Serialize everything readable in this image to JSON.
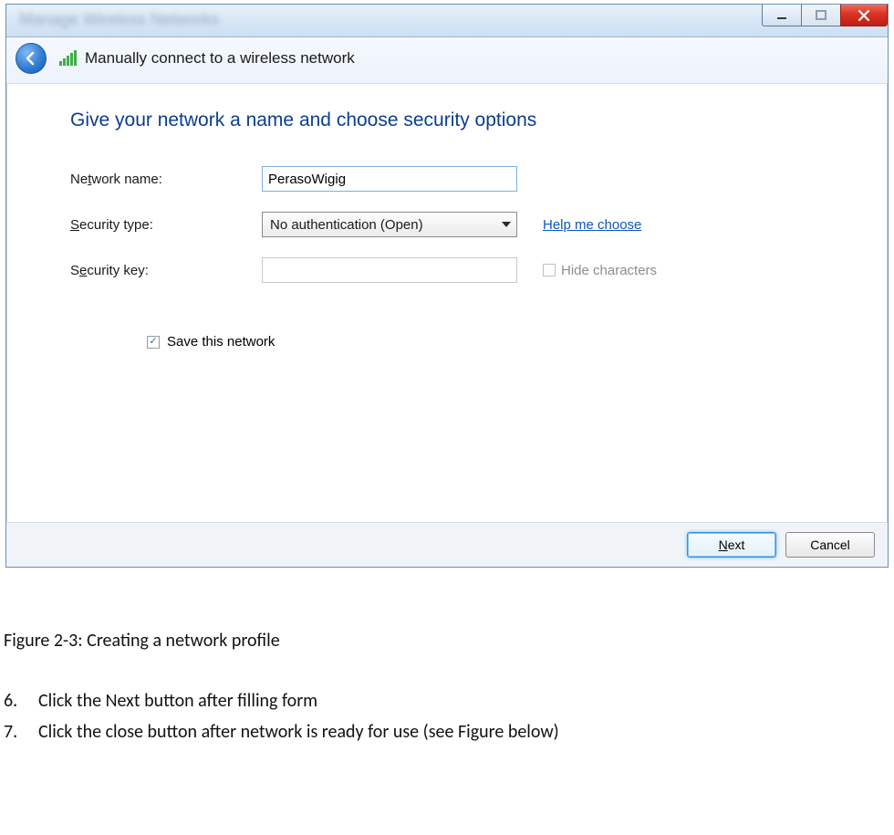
{
  "window": {
    "background_hint": "Manage Wireless Networks",
    "wizard_title": "Manually connect to a wireless network"
  },
  "content": {
    "heading": "Give your network a name and choose security options",
    "network_name_label": "Network name:",
    "network_name_value": "PerasoWigig",
    "security_type_label": "Security type:",
    "security_type_value": "No authentication (Open)",
    "help_link": "Help me choose",
    "security_key_label": "Security key:",
    "security_key_value": "",
    "hide_chars_label": "Hide characters",
    "save_label": "Save this network"
  },
  "buttons": {
    "next": "Next",
    "cancel": "Cancel"
  },
  "doc": {
    "caption": "Figure 2-3: Creating a network profile",
    "step6_num": "6.",
    "step6_text": "Click the Next button after filling form",
    "step7_num": "7.",
    "step7_text": "Click the close button after network is ready for use (see Figure below)"
  }
}
